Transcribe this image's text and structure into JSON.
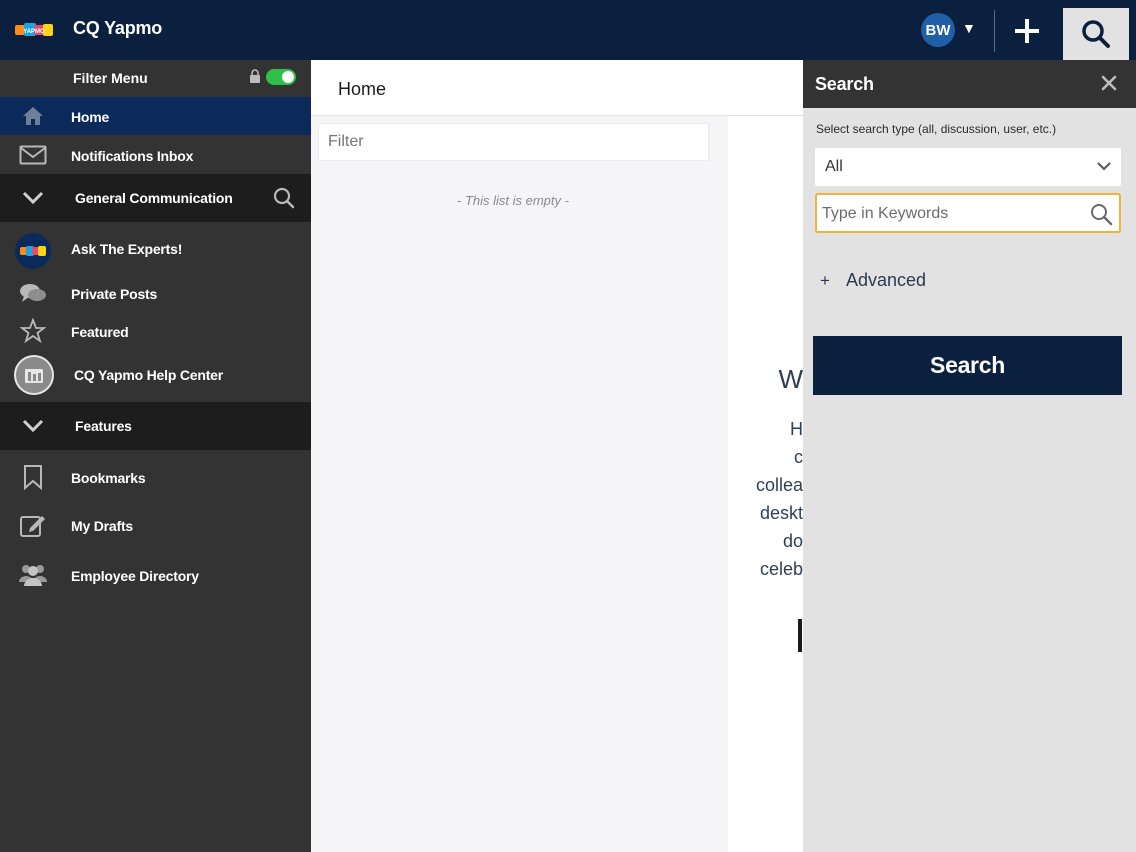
{
  "app": {
    "title": "CQ Yapmo",
    "logo_text": "YAPMO"
  },
  "user": {
    "initials": "BW"
  },
  "colors": {
    "navy": "#0b1f3e",
    "home_active": "#0b2a5a",
    "toggle_on": "#2fbf4a",
    "focus_border": "#f0b43a"
  },
  "sidebar": {
    "filter_menu_label": "Filter Menu",
    "filter_toggle_on": true,
    "home": "Home",
    "notifications": "Notifications Inbox",
    "section_general": "General Communication",
    "ask_experts": "Ask The Experts!",
    "private_posts": "Private Posts",
    "featured": "Featured",
    "help_center": "CQ Yapmo Help Center",
    "section_features": "Features",
    "bookmarks": "Bookmarks",
    "my_drafts": "My Drafts",
    "employee_directory": "Employee Directory"
  },
  "main": {
    "title": "Home",
    "filter_placeholder": "Filter",
    "empty_message": "- This list is empty -",
    "content_fragments": [
      "W",
      "H",
      "c",
      "collea",
      "deskt",
      "do",
      "celeb"
    ]
  },
  "search_panel": {
    "title": "Search",
    "type_label": "Select search type (all, discussion, user, etc.)",
    "type_value": "All",
    "keywords_placeholder": "Type in Keywords",
    "advanced_label": "Advanced",
    "advanced_symbol": "+",
    "search_button": "Search"
  }
}
